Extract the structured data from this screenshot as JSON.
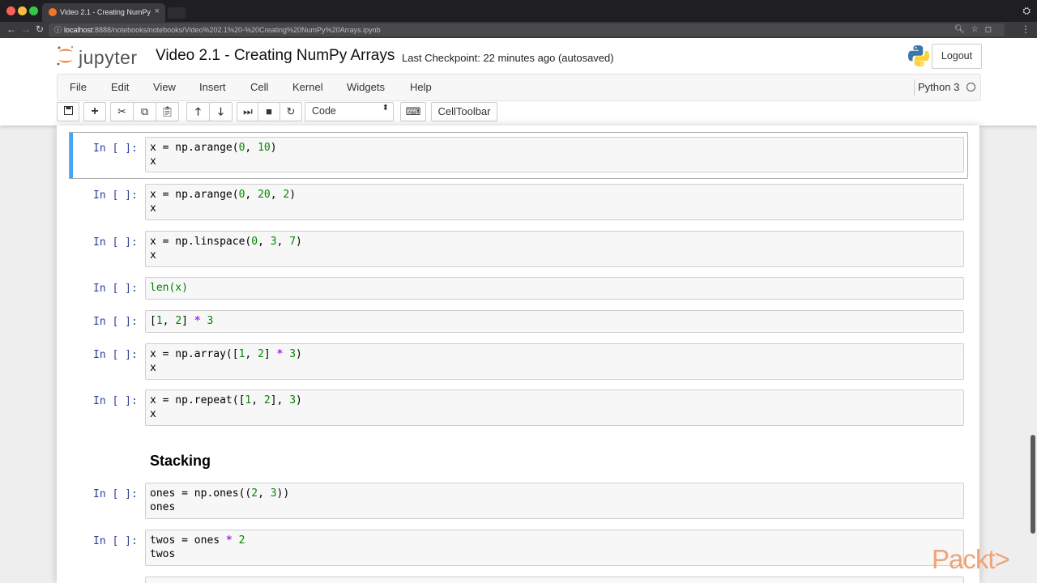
{
  "browser": {
    "tab_title": "Video 2.1 - Creating NumPy A",
    "tab_close": "×",
    "url_host": "localhost",
    "url_rest": ":8888/notebooks/notebooks/Video%202.1%20-%20Creating%20NumPy%20Arrays.ipynb"
  },
  "header": {
    "logo_text": "jupyter",
    "notebook_name": "Video 2.1 - Creating NumPy Arrays",
    "checkpoint": "Last Checkpoint: 22 minutes ago (autosaved)",
    "logout": "Logout"
  },
  "menu": {
    "items": [
      "File",
      "Edit",
      "View",
      "Insert",
      "Cell",
      "Kernel",
      "Widgets",
      "Help"
    ],
    "kernel_name": "Python 3"
  },
  "toolbar": {
    "cell_type": "Code",
    "celltoolbar": "CellToolbar"
  },
  "cells": [
    {
      "prompt": "In [ ]:",
      "lines": [
        [
          "x = np.arange(",
          "0",
          ", ",
          "10",
          ")"
        ],
        [
          "x"
        ]
      ]
    },
    {
      "prompt": "In [ ]:",
      "lines": [
        [
          "x = np.arange(",
          "0",
          ", ",
          "20",
          ", ",
          "2",
          ")"
        ],
        [
          "x"
        ]
      ]
    },
    {
      "prompt": "In [ ]:",
      "lines": [
        [
          "x = np.linspace(",
          "0",
          ", ",
          "3",
          ", ",
          "7",
          ")"
        ],
        [
          "x"
        ]
      ]
    },
    {
      "prompt": "In [ ]:",
      "lines": [
        [
          "len(x)"
        ]
      ]
    },
    {
      "prompt": "In [ ]:",
      "lines": [
        [
          "[1, 2] * 3"
        ]
      ]
    },
    {
      "prompt": "In [ ]:",
      "lines": [
        [
          "x = np.array([1, 2] * 3)"
        ],
        [
          "x"
        ]
      ]
    },
    {
      "prompt": "In [ ]:",
      "lines": [
        [
          "x = np.repeat([1, 2], 3)"
        ],
        [
          "x"
        ]
      ]
    },
    {
      "prompt": "In [ ]:",
      "lines": [
        [
          "ones = np.ones((2, 3))"
        ],
        [
          "ones"
        ]
      ]
    },
    {
      "prompt": "In [ ]:",
      "lines": [
        [
          "twos = ones * 2"
        ],
        [
          "twos"
        ]
      ]
    }
  ],
  "markdown_heading": "Stacking",
  "watermark": "Packt>"
}
